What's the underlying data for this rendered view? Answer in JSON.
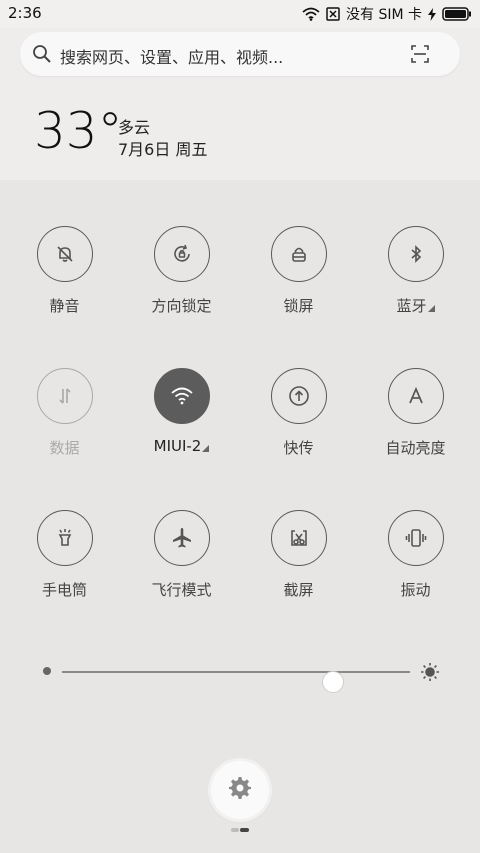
{
  "status": {
    "time": "2:36",
    "sim_text": "没有 SIM 卡",
    "icons": [
      "wifi-icon",
      "no-sim-icon",
      "charging-icon",
      "battery-icon"
    ]
  },
  "search": {
    "placeholder": "搜索网页、设置、应用、视频..."
  },
  "weather": {
    "temperature": "33°",
    "condition": "多云",
    "date": "7月6日 周五"
  },
  "tiles": [
    {
      "label": "静音",
      "icon": "silent-bell-icon",
      "state": "off"
    },
    {
      "label": "方向锁定",
      "icon": "rotation-lock-icon",
      "state": "off"
    },
    {
      "label": "锁屏",
      "icon": "lock-screen-icon",
      "state": "off"
    },
    {
      "label": "蓝牙",
      "icon": "bluetooth-icon",
      "state": "off",
      "has_more": true
    },
    {
      "label": "数据",
      "icon": "mobile-data-icon",
      "state": "disabled"
    },
    {
      "label": "MIUI-2",
      "icon": "wifi-icon",
      "state": "on",
      "has_more": true
    },
    {
      "label": "快传",
      "icon": "transfer-icon",
      "state": "off"
    },
    {
      "label": "自动亮度",
      "icon": "auto-brightness-icon",
      "state": "off"
    },
    {
      "label": "手电筒",
      "icon": "flashlight-icon",
      "state": "off"
    },
    {
      "label": "飞行模式",
      "icon": "airplane-icon",
      "state": "off"
    },
    {
      "label": "截屏",
      "icon": "screenshot-icon",
      "state": "off"
    },
    {
      "label": "振动",
      "icon": "vibrate-icon",
      "state": "off"
    }
  ],
  "brightness": {
    "level": 0.78
  },
  "colors": {
    "active_tile": "#5c5c5c",
    "background": "#e8e6e5"
  },
  "pager": {
    "pages": 2,
    "current": 1
  }
}
